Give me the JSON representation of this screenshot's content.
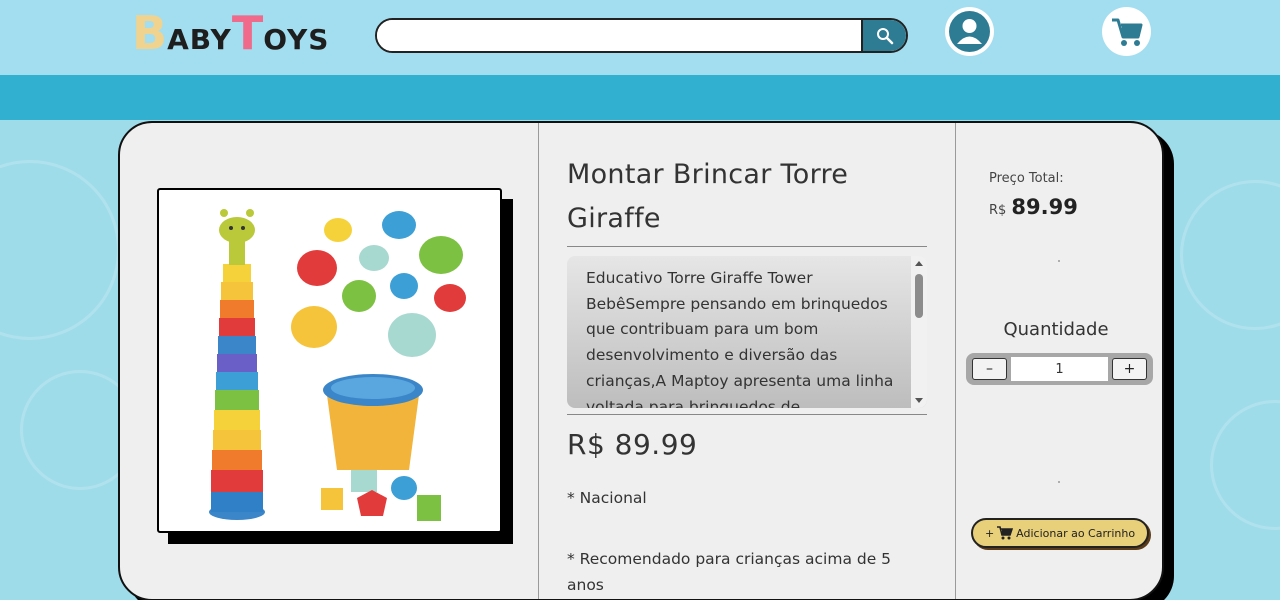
{
  "brand": {
    "logo_b": "B",
    "logo_aby": "ABY",
    "logo_t": "T",
    "logo_oys": "OYS"
  },
  "header": {
    "search_placeholder": "",
    "search_value": "",
    "search_icon": "search-icon",
    "user_icon": "user-icon",
    "cart_icon": "cart-icon"
  },
  "product": {
    "title": "Montar Brincar Torre Giraffe",
    "description": "Educativo Torre Giraffe Tower BebêSempre pensando em brinquedos que contribuam para um bom desenvolvimento e diversão das crianças,A Maptoy apresenta uma linha voltada para brinquedos de",
    "price": "R$ 89.99",
    "note_origin": "* Nacional",
    "note_age": "* Recomendado para crianças acima de 5 anos"
  },
  "purchase": {
    "total_label": "Preço Total:",
    "currency": "R$",
    "total_value": "89.99",
    "quantity_label": "Quantidade",
    "minus_label": "–",
    "plus_label": "+",
    "quantity_value": "1",
    "add_prefix": "+",
    "add_label": "Adicionar ao Carrinho"
  },
  "colors": {
    "header_bg": "#a2def0",
    "nav_bar": "#31b0cf",
    "page_bg": "#9fdcea",
    "accent": "#2e7c93",
    "add_cart_bg": "#e8cf79"
  }
}
